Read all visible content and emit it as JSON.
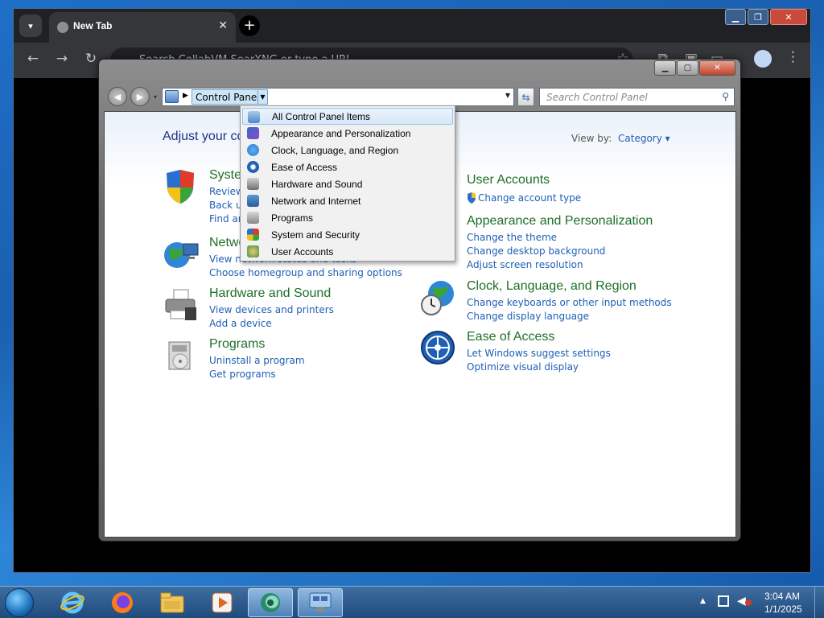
{
  "chrome": {
    "tab_title": "New Tab",
    "tab_close": "✕",
    "newtab": "+",
    "omnibox_placeholder": "Search CollabVM SearXNG or type a URL",
    "win_min": "▁",
    "win_max": "❐",
    "win_close": "✕"
  },
  "control_panel": {
    "win_min": "▁",
    "win_max": "▢",
    "win_close": "✕",
    "breadcrumb": "Control Panel",
    "search_placeholder": "Search Control Panel",
    "heading": "Adjust your computer's settings",
    "view_by_label": "View by:",
    "view_by_value": "Category ▾",
    "categories": [
      {
        "title": "System and Security",
        "links": [
          "Review your computer's status",
          "Back up your computer",
          "Find and fix problems"
        ]
      },
      {
        "title": "Network and Internet",
        "links": [
          "View network status and tasks",
          "Choose homegroup and sharing options"
        ]
      },
      {
        "title": "Hardware and Sound",
        "links": [
          "View devices and printers",
          "Add a device"
        ]
      },
      {
        "title": "Programs",
        "links": [
          "Uninstall a program",
          "Get programs"
        ]
      },
      {
        "title": "User Accounts",
        "links": [
          "Change account type"
        ]
      },
      {
        "title": "Appearance and Personalization",
        "links": [
          "Change the theme",
          "Change desktop background",
          "Adjust screen resolution"
        ]
      },
      {
        "title": "Clock, Language, and Region",
        "links": [
          "Change keyboards or other input methods",
          "Change display language"
        ]
      },
      {
        "title": "Ease of Access",
        "links": [
          "Let Windows suggest settings",
          "Optimize visual display"
        ]
      }
    ]
  },
  "dropdown": {
    "items": [
      "All Control Panel Items",
      "Appearance and Personalization",
      "Clock, Language, and Region",
      "Ease of Access",
      "Hardware and Sound",
      "Network and Internet",
      "Programs",
      "System and Security",
      "User Accounts"
    ],
    "selected_index": 0
  },
  "taskbar": {
    "time": "3:04 AM",
    "date": "1/1/2025"
  }
}
